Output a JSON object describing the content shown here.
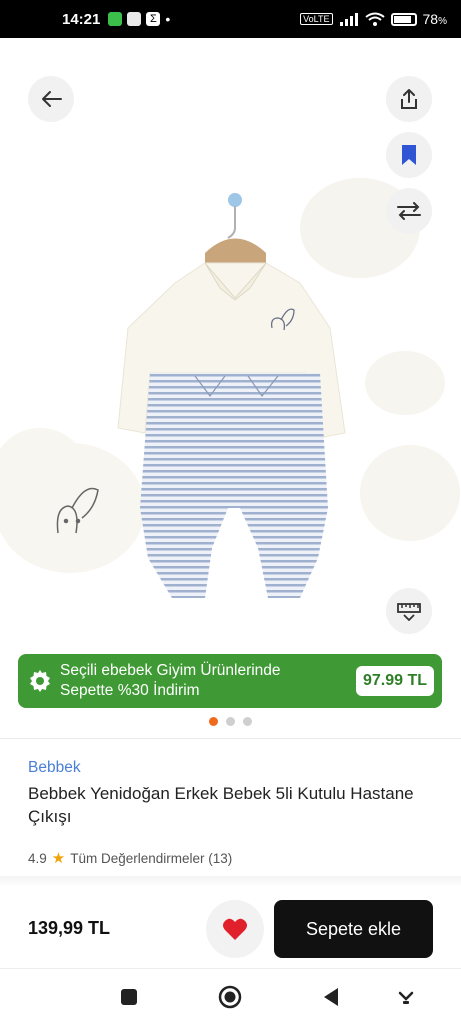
{
  "status_bar": {
    "time": "14:21",
    "battery": "78",
    "battery_suffix": "%"
  },
  "image_controls": {
    "back_icon": "arrow-left-icon",
    "share_icon": "share-icon",
    "bookmark_icon": "bookmark-icon",
    "compare_icon": "compare-arrows-icon",
    "size_icon": "ruler-icon"
  },
  "promo": {
    "line1": "Seçili ebebek Giyim Ürünlerinde",
    "line2": "Sepette %30 İndirim",
    "price": "97.99 TL",
    "bg_color": "#3f9a35"
  },
  "carousel": {
    "total": 3,
    "active": 1
  },
  "product": {
    "brand": "Bebbek",
    "title": "Bebbek Yenidoğan Erkek Bebek 5li Kutulu Hastane Çıkışı",
    "rating": "4.9",
    "reviews_label": "Tüm Değerlendirmeler (13)"
  },
  "bottom_bar": {
    "price": "139,99 TL",
    "cart_label": "Sepete ekle",
    "favorite_color": "#e0202b"
  }
}
